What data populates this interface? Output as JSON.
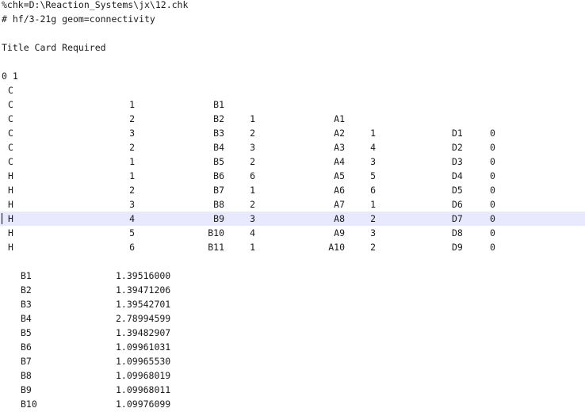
{
  "editor": {
    "highlight_color": "#e8e8ff",
    "text_color": "#1a1a1a",
    "active_line": 9,
    "header": {
      "chk": "%chk=D:\\Reaction_Systems\\jx\\12.chk",
      "route": "# hf/3-21g geom=connectivity",
      "title": "Title Card Required",
      "charge_mult": "0 1"
    },
    "zmatrix": [
      {
        "atom": "C"
      },
      {
        "atom": "C",
        "r1": "1",
        "bl": "B1"
      },
      {
        "atom": "C",
        "r1": "2",
        "bl": "B2",
        "r2": "1",
        "al": "A1"
      },
      {
        "atom": "C",
        "r1": "3",
        "bl": "B3",
        "r2": "2",
        "al": "A2",
        "r3": "1",
        "dl": "D1",
        "f": "0"
      },
      {
        "atom": "C",
        "r1": "2",
        "bl": "B4",
        "r2": "3",
        "al": "A3",
        "r3": "4",
        "dl": "D2",
        "f": "0"
      },
      {
        "atom": "C",
        "r1": "1",
        "bl": "B5",
        "r2": "2",
        "al": "A4",
        "r3": "3",
        "dl": "D3",
        "f": "0"
      },
      {
        "atom": "H",
        "r1": "1",
        "bl": "B6",
        "r2": "6",
        "al": "A5",
        "r3": "5",
        "dl": "D4",
        "f": "0"
      },
      {
        "atom": "H",
        "r1": "2",
        "bl": "B7",
        "r2": "1",
        "al": "A6",
        "r3": "6",
        "dl": "D5",
        "f": "0"
      },
      {
        "atom": "H",
        "r1": "3",
        "bl": "B8",
        "r2": "2",
        "al": "A7",
        "r3": "1",
        "dl": "D6",
        "f": "0"
      },
      {
        "atom": "H",
        "r1": "4",
        "bl": "B9",
        "r2": "3",
        "al": "A8",
        "r3": "2",
        "dl": "D7",
        "f": "0"
      },
      {
        "atom": "H",
        "r1": "5",
        "bl": "B10",
        "r2": "4",
        "al": "A9",
        "r3": "3",
        "dl": "D8",
        "f": "0"
      },
      {
        "atom": "H",
        "r1": "6",
        "bl": "B11",
        "r2": "1",
        "al": "A10",
        "r3": "2",
        "dl": "D9",
        "f": "0"
      }
    ],
    "variables": [
      {
        "name": "B1",
        "value": "1.39516000"
      },
      {
        "name": "B2",
        "value": "1.39471206"
      },
      {
        "name": "B3",
        "value": "1.39542701"
      },
      {
        "name": "B4",
        "value": "2.78994599"
      },
      {
        "name": "B5",
        "value": "1.39482907"
      },
      {
        "name": "B6",
        "value": "1.09961031"
      },
      {
        "name": "B7",
        "value": "1.09965530"
      },
      {
        "name": "B8",
        "value": "1.09968019"
      },
      {
        "name": "B9",
        "value": "1.09968011"
      },
      {
        "name": "B10",
        "value": "1.09976099"
      }
    ]
  }
}
